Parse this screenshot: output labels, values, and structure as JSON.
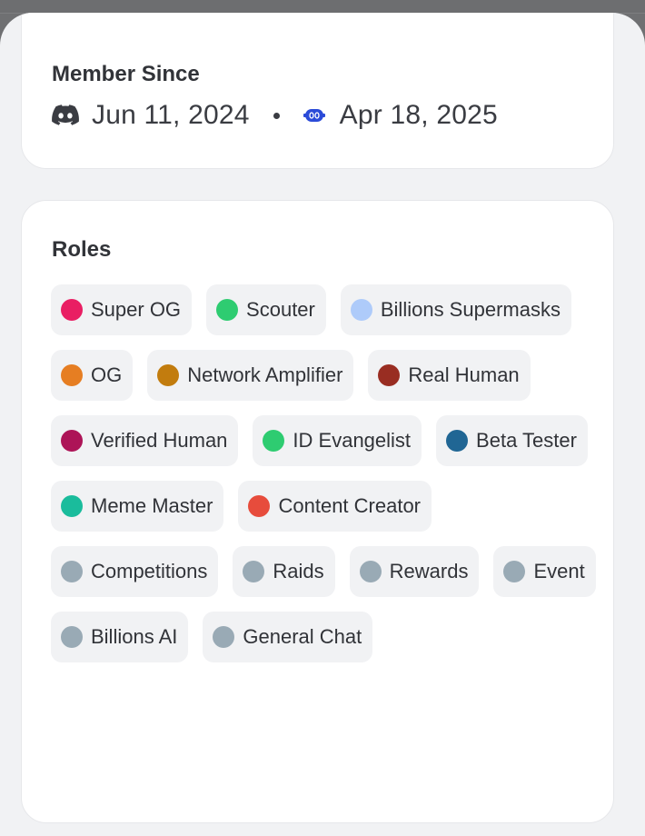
{
  "member_since": {
    "title": "Member Since",
    "discord_date": "Jun 11, 2024",
    "server_date": "Apr 18, 2025",
    "discord_icon": "discord-icon",
    "server_icon": "bot-icon",
    "discord_icon_color": "#3a3c42",
    "server_icon_color": "#2b4bd8"
  },
  "roles": {
    "title": "Roles",
    "items": [
      {
        "name": "Super OG",
        "color": "#e91e63"
      },
      {
        "name": "Scouter",
        "color": "#2ecc71"
      },
      {
        "name": "Billions Supermasks",
        "color": "#aecbfa"
      },
      {
        "name": "OG",
        "color": "#e67e22"
      },
      {
        "name": "Network Amplifier",
        "color": "#c27c0e"
      },
      {
        "name": "Real Human",
        "color": "#992d22"
      },
      {
        "name": "Verified Human",
        "color": "#ad1457"
      },
      {
        "name": "ID Evangelist",
        "color": "#2ecc71"
      },
      {
        "name": "Beta Tester",
        "color": "#206694"
      },
      {
        "name": "Meme Master",
        "color": "#1abc9c"
      },
      {
        "name": "Content Creator",
        "color": "#e74c3c"
      },
      {
        "name": "Competitions",
        "color": "#99aab5"
      },
      {
        "name": "Raids",
        "color": "#99aab5"
      },
      {
        "name": "Rewards",
        "color": "#99aab5"
      },
      {
        "name": "Event",
        "color": "#99aab5"
      },
      {
        "name": "Billions AI",
        "color": "#99aab5"
      },
      {
        "name": "General Chat",
        "color": "#99aab5"
      }
    ]
  }
}
